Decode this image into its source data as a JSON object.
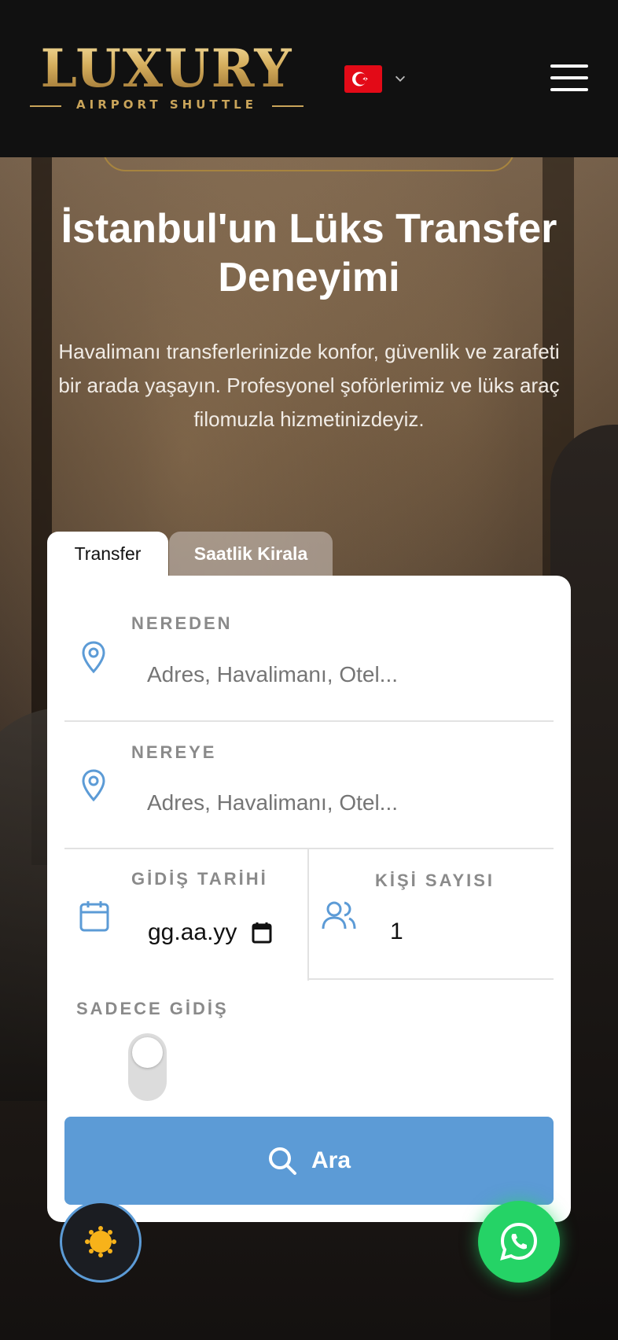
{
  "header": {
    "logo_main": "LUXURY",
    "logo_sub": "AIRPORT SHUTTLE",
    "language_flag": "turkey-flag",
    "menu_icon": "hamburger-icon"
  },
  "hero": {
    "title": "İstanbul'un Lüks Transfer Deneyimi",
    "description": "Havalimanı transferlerinizde konfor, güvenlik ve zarafeti bir arada yaşayın. Profesyonel şoförlerimiz ve lüks araç filomuzla hizmetinizdeyiz."
  },
  "booking": {
    "tabs": [
      {
        "label": "Transfer",
        "active": true
      },
      {
        "label": "Saatlik Kirala",
        "active": false
      }
    ],
    "from": {
      "label": "NEREDEN",
      "placeholder": "Adres, Havalimanı, Otel..."
    },
    "to": {
      "label": "NEREYE",
      "placeholder": "Adres, Havalimanı, Otel..."
    },
    "date": {
      "label": "GİDİŞ TARİHİ",
      "value": "gg.aa.yy"
    },
    "passengers": {
      "label": "KİŞİ SAYISI",
      "value": "1"
    },
    "one_way": {
      "label": "SADECE GİDİŞ",
      "checked": false
    },
    "search_label": "Ara"
  },
  "colors": {
    "accent": "#5c9bd6",
    "gold": "#c9a45a",
    "whatsapp": "#25d366"
  }
}
